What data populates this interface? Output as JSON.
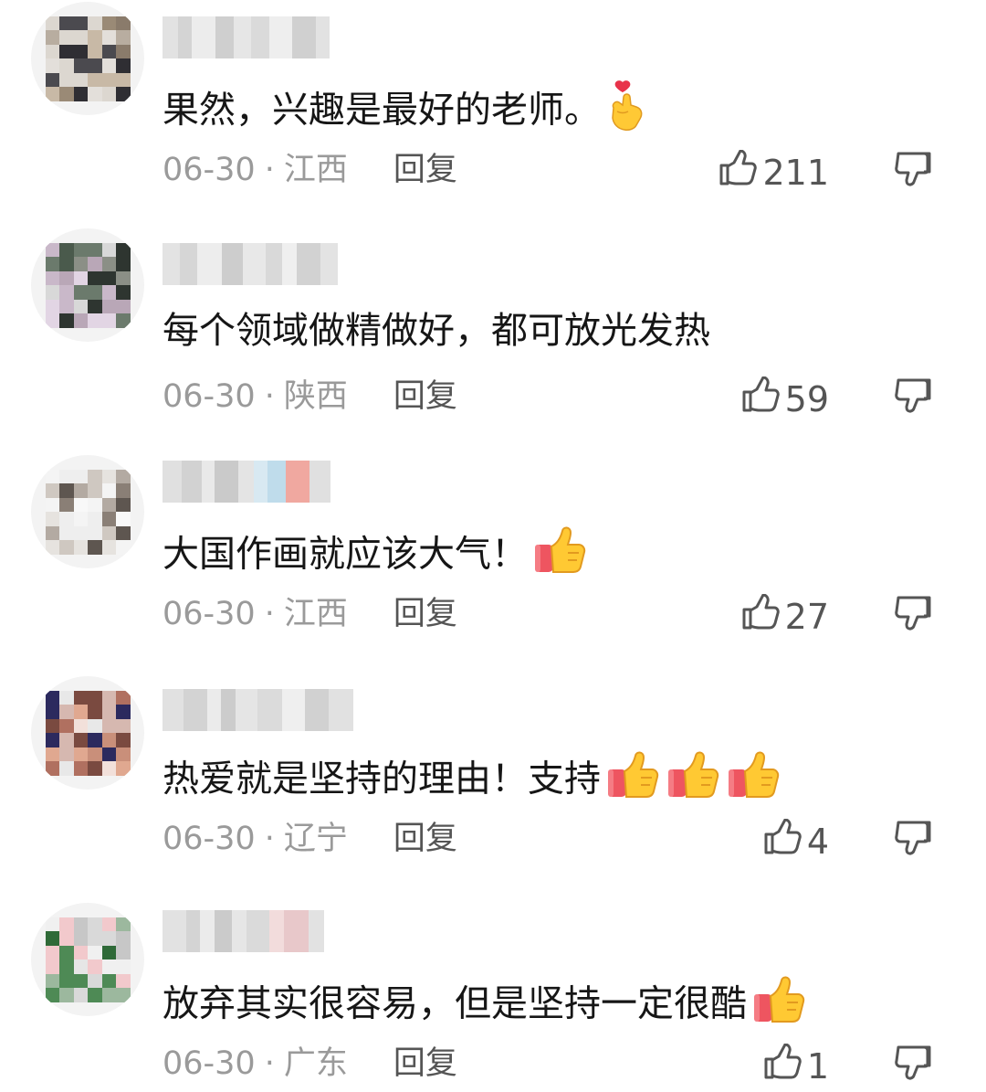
{
  "comments": [
    {
      "text": "果然，兴趣是最好的老师。",
      "emoji_icon": "finger-heart-icon",
      "date": "06-30",
      "location": "江西",
      "reply_label": "回复",
      "likes": "211"
    },
    {
      "text": "每个领域做精做好，都可放光发热",
      "date": "06-30",
      "location": "陕西",
      "reply_label": "回复",
      "likes": "59"
    },
    {
      "text": "大国作画就应该大气！",
      "emoji_icon": "thumbs-up-icon",
      "date": "06-30",
      "location": "江西",
      "reply_label": "回复",
      "likes": "27"
    },
    {
      "text": "热爱就是坚持的理由！支持",
      "emoji_icon": "thumbs-up-icon",
      "emoji_count": 3,
      "date": "06-30",
      "location": "辽宁",
      "reply_label": "回复",
      "likes": "4"
    },
    {
      "text": "放弃其实很容易，但是坚持一定很酷",
      "emoji_icon": "thumbs-up-icon",
      "date": "06-30",
      "location": "广东",
      "reply_label": "回复",
      "likes": "1"
    }
  ],
  "separator": "·",
  "colors": {
    "meta_text": "#9a9a9a",
    "reply_text": "#555555",
    "comment_text": "#161616",
    "icon_stroke": "#555555"
  }
}
